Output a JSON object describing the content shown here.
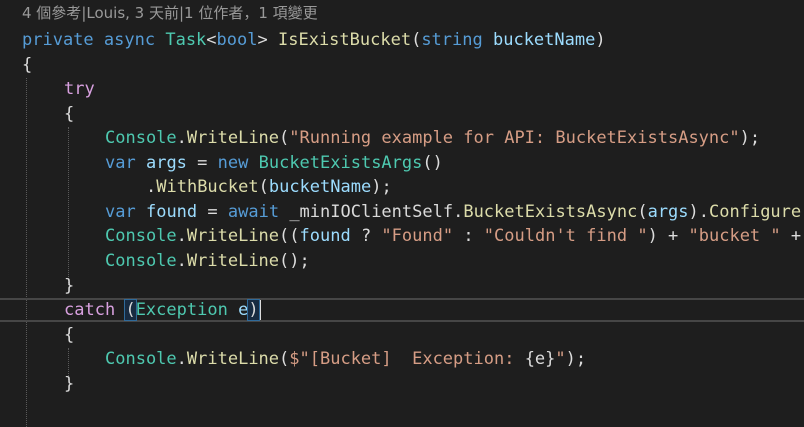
{
  "codelens": {
    "references": "4 個參考",
    "author": "Louis, 3 天前",
    "authors": "1 位作者，1 項變更"
  },
  "code": {
    "l1": {
      "kw_private": "private",
      "kw_async": "async",
      "type_task": "Task",
      "lt": "<",
      "kw_bool": "bool",
      "gt": ">",
      "method_name": "IsExistBucket",
      "lparen": "(",
      "kw_string": "string",
      "param": "bucketName",
      "rparen": ")"
    },
    "l2": {
      "brace": "{"
    },
    "l3": {
      "kw_try": "try"
    },
    "l4": {
      "brace": "{"
    },
    "l5": {
      "type": "Console",
      "dot": ".",
      "method": "WriteLine",
      "lparen": "(",
      "str": "\"Running example for API: BucketExistsAsync\"",
      "end": ");"
    },
    "l6": {
      "kw_var": "var",
      "ident": "args",
      "eq": " = ",
      "kw_new": "new",
      "type": "BucketExistsArgs",
      "end": "()"
    },
    "l7": {
      "dot": ".",
      "method": "WithBucket",
      "lparen": "(",
      "arg": "bucketName",
      "end": ");"
    },
    "l8": {
      "kw_var": "var",
      "ident": "found",
      "eq": " = ",
      "kw_await": "await",
      "field": "_minIOClientSelf",
      "dot": ".",
      "method": "BucketExistsAsync",
      "lparen": "(",
      "arg": "args",
      "mid": ").",
      "method2": "Configure"
    },
    "l9": {
      "type": "Console",
      "dot": ".",
      "method": "WriteLine",
      "lparen": "((",
      "ident": "found",
      "op1": " ? ",
      "str1": "\"Found\"",
      "op2": " : ",
      "str2": "\"Couldn't find \"",
      "op3": ") + ",
      "str3": "\"bucket \"",
      "op4": " +"
    },
    "l10": {
      "type": "Console",
      "dot": ".",
      "method": "WriteLine",
      "end": "();"
    },
    "l11": {
      "brace": "}"
    },
    "l12": {
      "kw_catch": "catch",
      "lparen": "(",
      "type": "Exception",
      "ident": "e",
      "rparen": ")"
    },
    "l13": {
      "brace": "{"
    },
    "l14": {
      "type": "Console",
      "dot": ".",
      "method": "WriteLine",
      "lparen": "(",
      "str": "$\"[Bucket]  Exception: ",
      "interp": "{e}",
      "strend": "\"",
      "end": ");"
    },
    "l15": {
      "brace": "}"
    }
  }
}
